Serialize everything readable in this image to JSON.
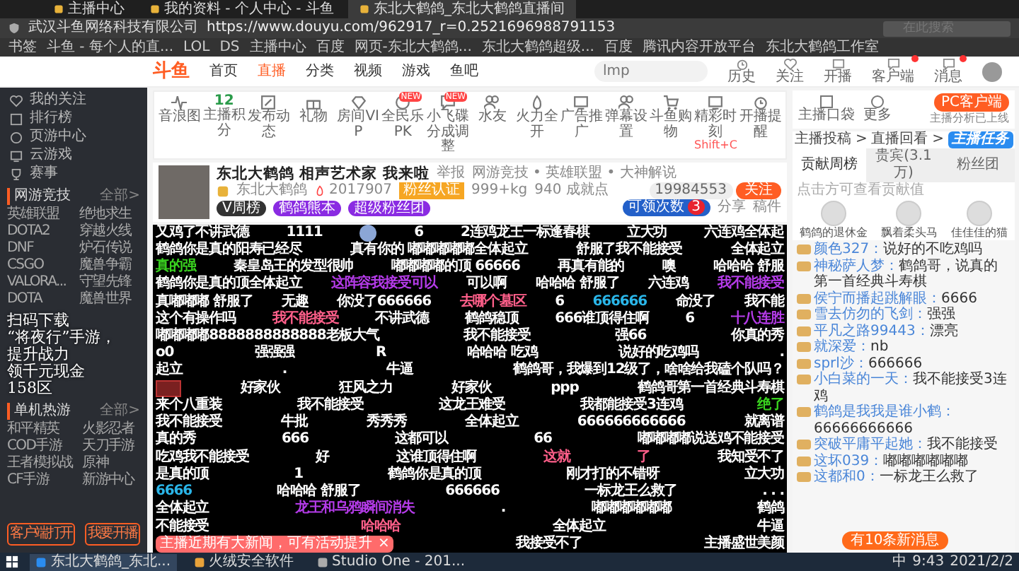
{
  "browser": {
    "tabs": [
      {
        "label": "主播中心",
        "selected": false
      },
      {
        "label": "我的资料 - 个人中心 - 斗鱼",
        "selected": false
      },
      {
        "label": "东北大鹤鸽_东北大鹤鸽直播间",
        "selected": true
      }
    ],
    "identity": "武汉斗鱼网络科技有限公司",
    "url": "https://www.douyu.com/962917_r=0.2521696988791153",
    "search_placeholder": "在此搜索",
    "bookmarks": [
      "书签",
      "斗鱼 - 每个人的直...",
      "LOL",
      "DS",
      "主播中心",
      "百度",
      "网页-东北大鹤鸽...",
      "东北大鹤鸽超级...",
      "百度",
      "腾讯内容开放平台",
      "东北大鹤鸽工作室"
    ]
  },
  "site_header": {
    "logo": "斗鱼",
    "nav": [
      {
        "label": "首页",
        "selected": false
      },
      {
        "label": "直播",
        "selected": true
      },
      {
        "label": "分类",
        "selected": false
      },
      {
        "label": "视频",
        "selected": false
      },
      {
        "label": "游戏",
        "selected": false
      },
      {
        "label": "鱼吧",
        "selected": false
      }
    ],
    "search_placeholder": "lmp",
    "actions": [
      {
        "label": "历史",
        "dot": false
      },
      {
        "label": "关注",
        "dot": false
      },
      {
        "label": "开播",
        "dot": false
      },
      {
        "label": "客户端",
        "dot": true
      },
      {
        "label": "消息",
        "dot": true
      }
    ]
  },
  "sidebar": {
    "items": [
      "我的关注",
      "排行榜",
      "页游中心",
      "云游戏",
      "赛事"
    ],
    "sections": [
      {
        "title": "网游竞技",
        "more": "全部>",
        "games": [
          "英雄联盟",
          "绝地求生",
          "DOTA2",
          "穿越火线",
          "DNF",
          "炉石传说",
          "CSGO",
          "魔兽争霸",
          "VALORA...",
          "守望先锋",
          "DOTA",
          "魔兽世界"
        ]
      },
      {
        "title": "单机热游",
        "more": "全部>",
        "games": [
          "和平精英",
          "火影忍者",
          "COD手游",
          "天刀手游",
          "王者模拟战",
          "原神",
          "CF手游",
          "新游中心"
        ]
      }
    ],
    "ad_overlay": [
      "扫码下载",
      "“将夜行”手游，",
      "提升战力",
      "领千元现金",
      "158区"
    ],
    "buttons": [
      "客户端打开",
      "我要开播"
    ]
  },
  "toolbar": [
    {
      "label": "音浪图"
    },
    {
      "label": "主播积分",
      "value": "12"
    },
    {
      "label": "发布动态"
    },
    {
      "label": "礼物"
    },
    {
      "label": "房间VIP"
    },
    {
      "label": "全民乐PK",
      "badge": "NEW"
    },
    {
      "label": "小飞碟分成调整",
      "badge": "NEW"
    },
    {
      "label": "水友"
    },
    {
      "label": "火力全开"
    },
    {
      "label": "广告推广"
    },
    {
      "label": "弹幕设置"
    },
    {
      "label": "斗鱼购物"
    },
    {
      "label": "精彩时刻",
      "hint": "Shift+C"
    },
    {
      "label": "开播提醒"
    }
  ],
  "streamer": {
    "title": "东北大鹤鸽 相声艺术家 我来啦",
    "report": "举报",
    "category": "网游竞技 • 英雄联盟 • 大神解说",
    "followers": "19984553",
    "follow": "关注",
    "name": "东北大鹤鸽",
    "heat": "2017907",
    "certified": "粉丝认证",
    "weight": "999+kg",
    "achievements": "940 成就点",
    "pills": [
      "V周榜",
      "鹤鸽熊本",
      "超级粉丝团"
    ],
    "claim": {
      "label": "可领次数",
      "count": "3"
    },
    "share": "分享",
    "clip": "稿件"
  },
  "video": {
    "danmaku": [
      {
        "items": [
          {
            "text": "又鸡了不讲武德",
            "color": "#ffffff"
          },
          {
            "text": "1111",
            "color": "#ffffff"
          },
          {
            "text": "6",
            "color": "#ffffff"
          },
          {
            "text": "2连鸡龙王一标逢春棋",
            "color": "#ffffff"
          },
          {
            "text": "立大功",
            "color": "#ffffff"
          },
          {
            "text": "六连鸡全体起",
            "color": "#ffffff"
          }
        ]
      },
      {
        "items": [
          {
            "text": "鹤鸽你是真的阳寿已经尽",
            "color": "#ffffff"
          },
          {
            "text": "真有你的 嘟嘟嘟嘟嘟全体起立",
            "color": "#ffffff"
          },
          {
            "text": "舒服了我不能接受",
            "color": "#ffffff"
          },
          {
            "text": "全体起立",
            "color": "#ffffff"
          }
        ]
      },
      {
        "items": [
          {
            "text": "真的强",
            "color": "#39d21f"
          },
          {
            "text": "秦皇岛王的发型很帅",
            "color": "#ffffff"
          },
          {
            "text": "嘟嘟嘟嘟的顶 66666",
            "color": "#ffffff"
          },
          {
            "text": "再真有能的",
            "color": "#ffffff"
          },
          {
            "text": "噢",
            "color": "#ffffff"
          },
          {
            "text": "哈哈哈 舒服",
            "color": "#ffffff"
          }
        ]
      },
      {
        "items": [
          {
            "text": "鹤鸽你是真的顶全体起立",
            "color": "#ffffff"
          },
          {
            "text": "这阵容我接受可以",
            "color": "#b43be8"
          },
          {
            "text": "可以啊",
            "color": "#ffffff"
          },
          {
            "text": "哈哈哈 舒服了",
            "color": "#ffffff"
          },
          {
            "text": "六连鸡",
            "color": "#ffffff"
          },
          {
            "text": "我不能接受",
            "color": "#b43be8"
          }
        ]
      },
      {
        "items": [
          {
            "text": "真嘟嘟嘟 舒服了",
            "color": "#ffffff"
          },
          {
            "text": "无趣",
            "color": "#ffffff"
          },
          {
            "text": "你没了666666",
            "color": "#ffffff"
          },
          {
            "text": "去哪个墓区",
            "color": "#ff5f8a"
          },
          {
            "text": "6",
            "color": "#ffffff"
          },
          {
            "text": "666666",
            "color": "#2ab5e8"
          },
          {
            "text": "命没了",
            "color": "#ffffff"
          },
          {
            "text": "我不能",
            "color": "#ffffff"
          }
        ]
      },
      {
        "items": [
          {
            "text": "这个有操作吗",
            "color": "#ffffff"
          },
          {
            "text": "我不能接受",
            "color": "#ff5f8a"
          },
          {
            "text": "不讲武德",
            "color": "#ffffff"
          },
          {
            "text": "鹤鸽稳顶",
            "color": "#ffffff"
          },
          {
            "text": "666谁顶得住啊",
            "color": "#ffffff"
          },
          {
            "text": "6",
            "color": "#ffffff"
          },
          {
            "text": "十八连胜",
            "color": "#b43be8"
          }
        ]
      },
      {
        "items": [
          {
            "text": "嘟嘟嘟嘟8888888888888老板大气",
            "color": "#ffffff"
          },
          {
            "text": "我不能接受",
            "color": "#ffffff"
          },
          {
            "text": "强66",
            "color": "#ffffff"
          },
          {
            "text": "你真的秀",
            "color": "#ffffff"
          }
        ]
      },
      {
        "items": [
          {
            "text": "o0",
            "color": "#ffffff"
          },
          {
            "text": "强强强",
            "color": "#ffffff"
          },
          {
            "text": "R",
            "color": "#ffffff"
          },
          {
            "text": "哈哈哈 吃鸡",
            "color": "#ffffff"
          },
          {
            "text": "说好的吃鸡吗",
            "color": "#ffffff"
          },
          {
            "text": ".",
            "color": "#ffffff"
          }
        ]
      },
      {
        "items": [
          {
            "text": "起立",
            "color": "#ffffff"
          },
          {
            "text": ".",
            "color": "#ffffff"
          },
          {
            "text": "牛逼",
            "color": "#ffffff"
          },
          {
            "text": "鹤鸽哥，我爆到12级了，啥啥给我磕个队吗？",
            "color": "#ffffff"
          }
        ]
      },
      {
        "items": [
          {
            "text": "好家伙",
            "color": "#ffffff"
          },
          {
            "text": "狂风之力",
            "color": "#ffffff"
          },
          {
            "text": "好家伙",
            "color": "#ffffff"
          },
          {
            "text": "ppp",
            "color": "#ffffff"
          },
          {
            "text": "鹤鸽哥第一首经典斗寿棋",
            "color": "#ffffff"
          }
        ]
      },
      {
        "items": [
          {
            "text": "来个八重装",
            "color": "#ffffff"
          },
          {
            "text": "我不能接受",
            "color": "#ffffff"
          },
          {
            "text": "这龙王难受",
            "color": "#ffffff"
          },
          {
            "text": "我都能接受3连鸡",
            "color": "#ffffff"
          },
          {
            "text": "绝了",
            "color": "#39d21f"
          }
        ]
      },
      {
        "items": [
          {
            "text": "我不能接受",
            "color": "#ffffff"
          },
          {
            "text": "牛批",
            "color": "#ffffff"
          },
          {
            "text": "秀秀秀",
            "color": "#ffffff"
          },
          {
            "text": "全体起立",
            "color": "#ffffff"
          },
          {
            "text": "666666666666",
            "color": "#ffffff"
          },
          {
            "text": "就离谱",
            "color": "#ffffff"
          }
        ]
      },
      {
        "items": [
          {
            "text": "真的秀",
            "color": "#ffffff"
          },
          {
            "text": "666",
            "color": "#ffffff"
          },
          {
            "text": "这都可以",
            "color": "#ffffff"
          },
          {
            "text": "66",
            "color": "#ffffff"
          },
          {
            "text": "嘟嘟嘟嘟说送鸡不能接受",
            "color": "#ffffff"
          }
        ]
      },
      {
        "items": [
          {
            "text": "吃鸡我不能接受",
            "color": "#ffffff"
          },
          {
            "text": "好",
            "color": "#ffffff"
          },
          {
            "text": "这谁顶得住啊",
            "color": "#ffffff"
          },
          {
            "text": "这就",
            "color": "#ff5f8a"
          },
          {
            "text": "了",
            "color": "#ff5f8a"
          },
          {
            "text": "我知受不了",
            "color": "#ffffff"
          }
        ]
      },
      {
        "items": [
          {
            "text": "是真的顶",
            "color": "#ffffff"
          },
          {
            "text": "1",
            "color": "#ffffff"
          },
          {
            "text": "鹤鸽你是真的顶",
            "color": "#ffffff"
          },
          {
            "text": "刚才打的不错呀",
            "color": "#ffffff"
          },
          {
            "text": "立大功",
            "color": "#ffffff"
          }
        ]
      },
      {
        "items": [
          {
            "text": "6666",
            "color": "#2ab5e8"
          },
          {
            "text": "哈哈哈 舒服了",
            "color": "#ffffff"
          },
          {
            "text": "666666",
            "color": "#ffffff"
          },
          {
            "text": "一标龙王么救了",
            "color": "#ffffff"
          },
          {
            "text": ". . .",
            "color": "#ffffff"
          }
        ]
      },
      {
        "items": [
          {
            "text": "全体起立",
            "color": "#ffffff"
          },
          {
            "text": "龙王和乌鸦瞬间消失",
            "color": "#b43be8"
          },
          {
            "text": ".",
            "color": "#ffffff"
          },
          {
            "text": "嘟嘟嘟嘟嘟嘟",
            "color": "#ffffff"
          },
          {
            "text": "鹤鸽",
            "color": "#ffffff"
          }
        ]
      },
      {
        "items": [
          {
            "text": "不能接受",
            "color": "#ffffff"
          },
          {
            "text": "哈哈哈",
            "color": "#ff5f8a"
          },
          {
            "text": "全体起立",
            "color": "#ffffff"
          },
          {
            "text": "牛逼",
            "color": "#ffffff"
          }
        ]
      },
      {
        "items": [
          {
            "text": "我接受不了",
            "color": "#ffffff"
          },
          {
            "text": "主播盛世美颜",
            "color": "#ffffff"
          }
        ]
      }
    ],
    "toast": "主播近期有大新闻，可有活动提升",
    "toast_close": "×"
  },
  "right": {
    "tools": [
      "主播口袋",
      "更多"
    ],
    "pc_button": "PC客户端",
    "pc_note": "主播分析已上线",
    "links": [
      "主播投稿 >",
      "直播回看 >"
    ],
    "tabs": [
      {
        "label": "贡献周榜",
        "selected": true
      },
      {
        "label": "贵宾(3.1万)",
        "selected": false
      },
      {
        "label": "粉丝团",
        "selected": false
      }
    ],
    "hint": "点击方可查看贡献值",
    "top3": [
      "鹤鸽的退休金",
      "飘着柔头马",
      "佳佳佳的猫"
    ],
    "task_badge": "主播任务",
    "messages": [
      {
        "user": "颜色327：",
        "text": "说好的不吃鸡吗"
      },
      {
        "user": "神秘萨人梦：",
        "text": "鹤鸽哥，说真的第一首经典斗寿棋"
      },
      {
        "user": "侯宁而播起跳解眼：",
        "text": "6666"
      },
      {
        "user": "雪去仿勿的飞剑：",
        "text": "强强"
      },
      {
        "user": "平凡之路99443：",
        "text": "漂亮"
      },
      {
        "user": "就深爱：",
        "text": "nb"
      },
      {
        "user": "sprl沙：",
        "text": "666666"
      },
      {
        "user": "小白菜的一天：",
        "text": "我不能接受3连鸡"
      },
      {
        "user": "鹤鸽是我我是谁小鹤：",
        "text": "66666666666"
      },
      {
        "user": "突破平庸平起她：",
        "text": "我不能接受"
      },
      {
        "user": "这坏039：",
        "text": "嘟嘟嘟嘟嘟嘟"
      },
      {
        "user": "这都和0：",
        "text": "一标龙王么救了"
      }
    ],
    "new_messages": "有10条新消息"
  },
  "taskbar": {
    "apps": [
      "东北大鹤鸽_东北...",
      "火绒安全软件",
      "Studio One - 201..."
    ],
    "ime": "中",
    "time": "9:43",
    "date": "2021/2/2"
  }
}
